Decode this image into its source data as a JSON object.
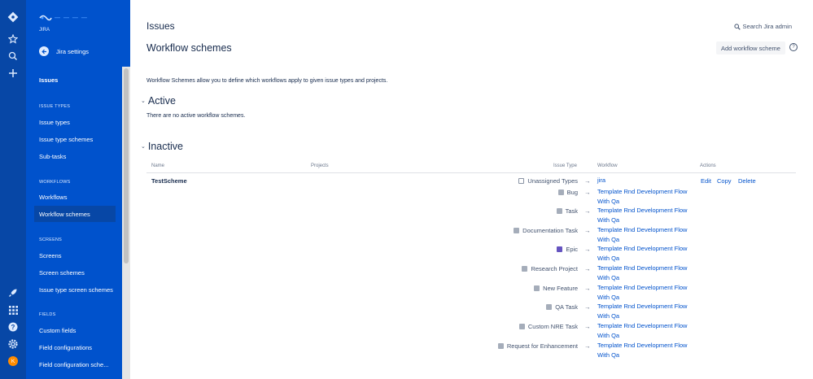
{
  "global_nav": {
    "icons": [
      "jira-logo-icon",
      "star-icon",
      "search-icon",
      "plus-icon",
      "rocket-icon",
      "app-grid-icon",
      "help-icon",
      "settings-icon"
    ],
    "avatar_initial": "K",
    "avatar_color": "#ff8b00"
  },
  "sidebar": {
    "project_name": "JIRA",
    "back_label": "Jira settings",
    "items": [
      {
        "label": "Issues"
      },
      {
        "label": "Issue types"
      },
      {
        "label": "Issue type schemes"
      },
      {
        "label": "Sub-tasks"
      },
      {
        "label": "Workflows"
      },
      {
        "label": "Workflow schemes"
      },
      {
        "label": "Screens"
      },
      {
        "label": "Screen schemes"
      },
      {
        "label": "Issue type screen schemes"
      },
      {
        "label": "Custom fields"
      },
      {
        "label": "Field configurations"
      },
      {
        "label": "Field configuration sche..."
      }
    ],
    "headings": [
      "ISSUE TYPES",
      "WORKFLOWS",
      "SCREENS",
      "FIELDS"
    ]
  },
  "header": {
    "breadcrumb": "Issues",
    "title": "Workflow schemes",
    "search_label": "Search Jira admin",
    "add_button": "Add workflow scheme"
  },
  "description": "Workflow Schemes allow you to define which workflows apply to given issue types and projects.",
  "active": {
    "title": "Active",
    "empty_text": "There are no active workflow schemes."
  },
  "inactive": {
    "title": "Inactive",
    "columns": {
      "name": "Name",
      "projects": "Projects",
      "issue_type": "Issue Type",
      "workflow": "Workflow",
      "actions": "Actions"
    },
    "scheme_name": "TestScheme",
    "actions": {
      "edit": "Edit",
      "copy": "Copy",
      "delete": "Delete"
    },
    "arrow": "→",
    "rows": [
      {
        "issue_type": "Unassigned Types",
        "workflow": "jira",
        "icon": "unassigned"
      },
      {
        "issue_type": "Bug",
        "workflow": "Template Rnd Development Flow With Qa",
        "icon": "bug"
      },
      {
        "issue_type": "Task",
        "workflow": "Template Rnd Development Flow With Qa",
        "icon": "task"
      },
      {
        "issue_type": "Documentation Task",
        "workflow": "Template Rnd Development Flow With Qa",
        "icon": "doc"
      },
      {
        "issue_type": "Epic",
        "workflow": "Template Rnd Development Flow With Qa",
        "icon": "epic"
      },
      {
        "issue_type": "Research Project",
        "workflow": "Template Rnd Development Flow With Qa",
        "icon": "research"
      },
      {
        "issue_type": "New Feature",
        "workflow": "Template Rnd Development Flow With Qa",
        "icon": "feature"
      },
      {
        "issue_type": "QA Task",
        "workflow": "Template Rnd Development Flow With Qa",
        "icon": "qa"
      },
      {
        "issue_type": "Custom NRE Task",
        "workflow": "Template Rnd Development Flow With Qa",
        "icon": "nre"
      },
      {
        "issue_type": "Request for Enhancement",
        "workflow": "Template Rnd Development Flow With Qa",
        "icon": "rfe"
      }
    ]
  },
  "colors": {
    "nav_dark": "#0747a6",
    "sidebar": "#0052cc",
    "link": "#0052cc",
    "epic": "#6554c0",
    "issue_icon": "#a5adba"
  }
}
